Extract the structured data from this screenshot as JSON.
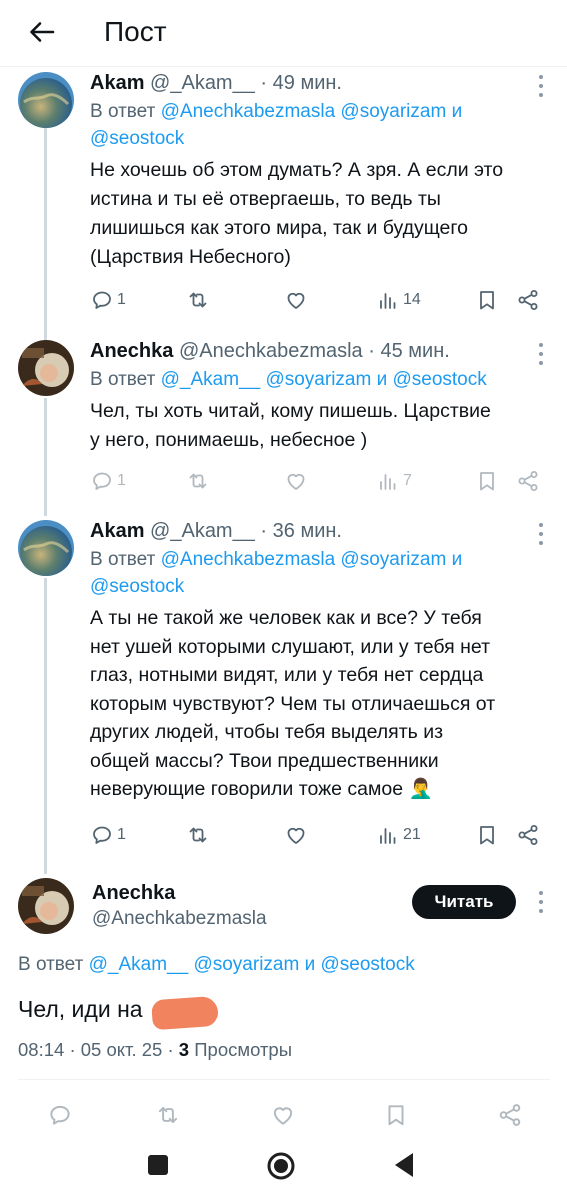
{
  "header": {
    "title": "Пост"
  },
  "tweets": [
    {
      "name": "Akam",
      "handle": "@_Akam__",
      "time": "49 мин.",
      "reply_prefix": "В ответ",
      "reply_line1": "@Anechkabezmasla @soyarizam и",
      "reply_line2": "@seostock",
      "text_lines": [
        "Не хочешь об этом думать? А зря. А если это",
        "истина и ты её отвергаешь, то ведь ты",
        "лишишься как этого мира, так и будущего",
        "(Царствия Небесного)"
      ],
      "replies": "1",
      "views": "14"
    },
    {
      "name": "Anechka",
      "handle": "@Anechkabezmasla",
      "time": "45 мин.",
      "reply_prefix": "В ответ",
      "reply_line1": "@_Akam__ @soyarizam и @seostock",
      "text_lines": [
        "Чел, ты хоть читай, кому пишешь. Царствие",
        "у него, понимаешь, небесное )"
      ],
      "replies": "1",
      "views": "7"
    },
    {
      "name": "Akam",
      "handle": "@_Akam__",
      "time": "36 мин.",
      "reply_prefix": "В ответ",
      "reply_line1": "@Anechkabezmasla @soyarizam и",
      "reply_line2": "@seostock",
      "text_lines": [
        "А ты не такой же человек как и все? У тебя",
        "нет ушей которыми слушают, или у тебя нет",
        "глаз, нотными видят, или у тебя нет сердца",
        "которым чувствуют? Чем ты отличаешься от",
        "других людей, чтобы тебя выделять из",
        "общей массы? Твои предшественники",
        "неверующие говорили тоже самое 🤦‍♂️"
      ],
      "replies": "1",
      "views": "21"
    }
  ],
  "main_tweet": {
    "name": "Anechka",
    "handle": "@Anechkabezmasla",
    "follow_label": "Читать",
    "reply_prefix": "В ответ",
    "reply_mentions": "@_Akam__ @soyarizam и @seostock",
    "text": "Чел, иди на",
    "time": "08:14",
    "date": "05 окт. 25",
    "views_count": "3",
    "views_label": "Просмотры"
  },
  "icons": {
    "back": "arrow-left-icon",
    "more": "more-vertical-icon",
    "reply": "comment-icon",
    "retweet": "retweet-icon",
    "like": "heart-icon",
    "views": "bar-chart-icon",
    "bookmark": "bookmark-icon",
    "share": "share-icon"
  },
  "colors": {
    "link": "#1d9bf0",
    "muted": "#536471",
    "text": "#0f1419",
    "redaction": "#f1845f"
  }
}
